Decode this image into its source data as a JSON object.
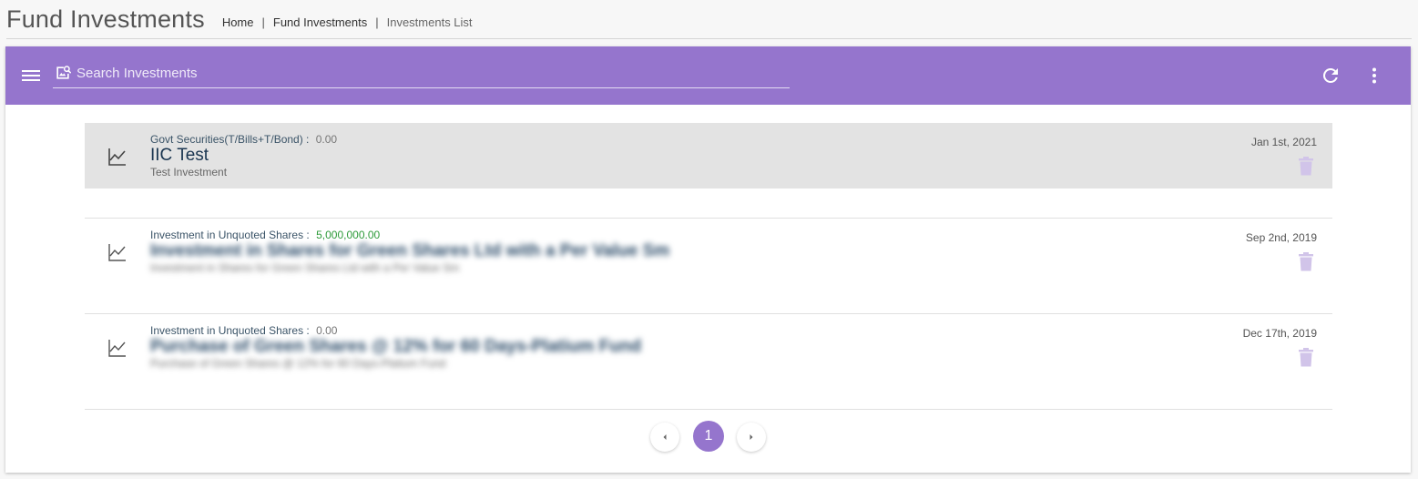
{
  "header": {
    "title": "Fund Investments",
    "breadcrumb": [
      {
        "label": "Home"
      },
      {
        "label": "Fund Investments"
      },
      {
        "label": "Investments List"
      }
    ],
    "separator": "|"
  },
  "toolbar": {
    "bg_color": "#9575cd",
    "search_placeholder": "Search Investments",
    "icons": {
      "menu": "menu-icon",
      "search": "image-search-icon",
      "refresh": "refresh-icon",
      "more": "more-vert-icon"
    }
  },
  "investments": [
    {
      "category": "Govt Securities(T/Bills+T/Bond) :",
      "amount": "0.00",
      "title": "IIC Test",
      "subtitle": "Test Investment",
      "date": "Jan 1st, 2021",
      "selected": true,
      "blurred": false
    },
    {
      "category": "Investment in Unquoted Shares :",
      "amount": "5,000,000.00",
      "title": "Investment in Shares for Green Shares Ltd with a Per Value Sm",
      "subtitle": "Investment in Shares for Green Shares Ltd with a Per Value Sm",
      "date": "Sep 2nd, 2019",
      "selected": false,
      "blurred": true
    },
    {
      "category": "Investment in Unquoted Shares :",
      "amount": "0.00",
      "title": "Purchase of Green Shares @ 12% for 60 Days-Platium Fund",
      "subtitle": "Purchase of Green Shares @ 12% for 60 Days-Platium Fund",
      "date": "Dec 17th, 2019",
      "selected": false,
      "blurred": true
    }
  ],
  "pagination": {
    "current_page": "1",
    "prev_icon": "chevron-left-icon",
    "next_icon": "chevron-right-icon"
  },
  "colors": {
    "accent": "#9575cd",
    "delete_icon": "#d1c4e9",
    "positive_amount": "#2e9b3a"
  }
}
